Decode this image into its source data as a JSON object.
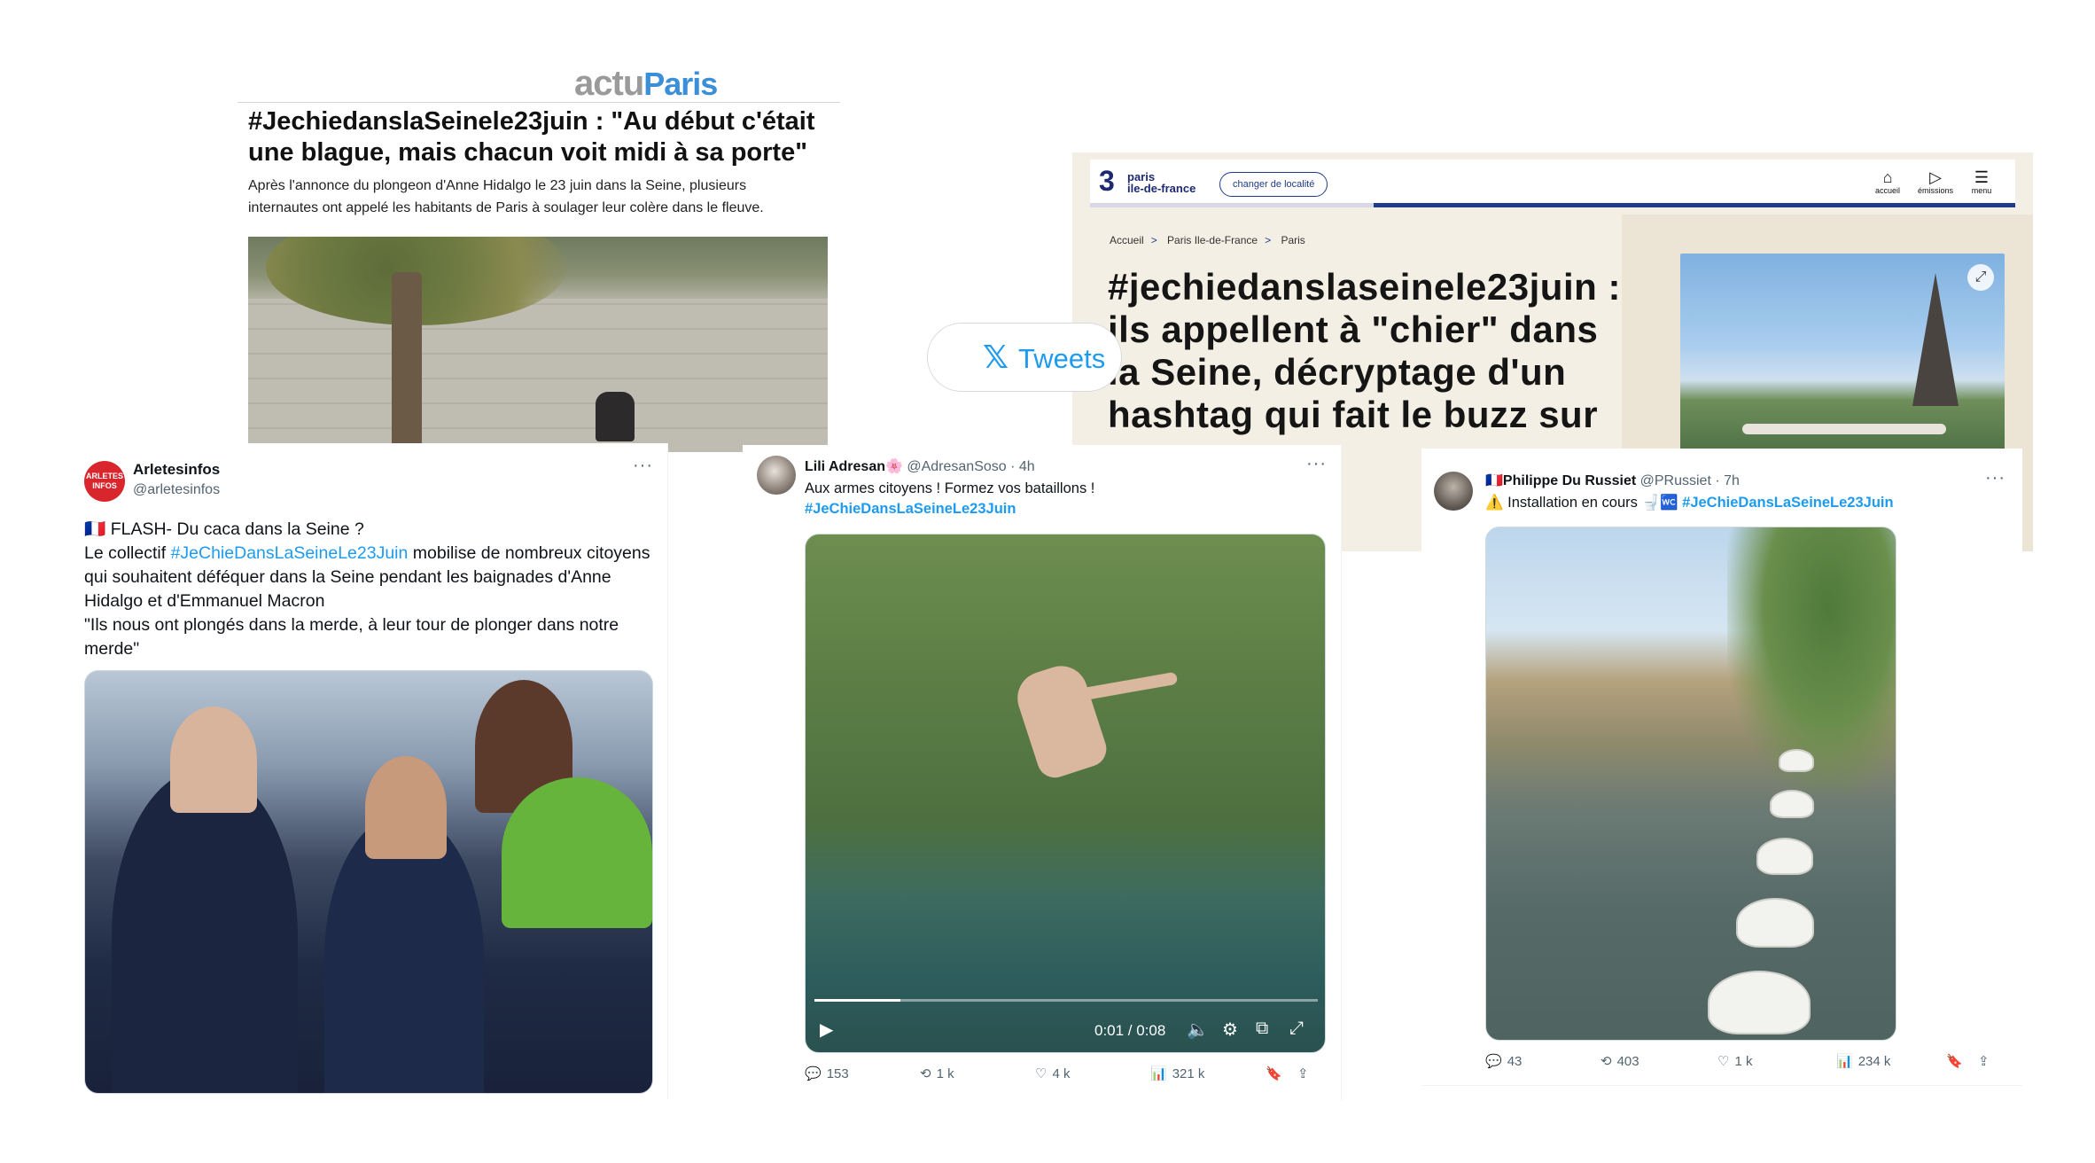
{
  "actu": {
    "logo_actu": "actu",
    "logo_paris": "Paris",
    "headline": "#JechiedanslaSeinele23juin : \"Au début c'était une blague, mais chacun voit midi à sa porte\"",
    "lead": "Après l'annonce du plongeon d'Anne Hidalgo le 23 juin dans la Seine, plusieurs internautes ont appelé les habitants de Paris à soulager leur colère dans le fleuve."
  },
  "tweets_pill": {
    "icon": "x-logo-icon",
    "label": "Tweets"
  },
  "france3": {
    "brand_num": "3",
    "brand_line1": "paris",
    "brand_line2": "ile-de-france",
    "location_button": "changer de localité",
    "nav": [
      {
        "icon": "⌂",
        "label": "accueil"
      },
      {
        "icon": "▷",
        "label": "émissions"
      },
      {
        "icon": "☰",
        "label": "menu"
      }
    ],
    "breadcrumb": [
      "Accueil",
      "Paris Ile-de-France",
      "Paris"
    ],
    "breadcrumb_sep": ">",
    "title": "#jechiedanslaseinele23juin : ils appellent à \"chier\" dans la Seine, décryptage d'un hashtag qui fait le buzz sur",
    "accent_color": "#1f3b8c"
  },
  "tweet1": {
    "avatar_text": "ARLETES INFOS",
    "name": "Arletesinfos",
    "handle": "@arletesinfos",
    "more": "···",
    "line1": "🇫🇷 FLASH- Du caca dans la Seine ?",
    "line2_pre": "Le collectif ",
    "line2_tag": "#JeChieDansLaSeineLe23Juin",
    "line2_post": " mobilise de nombreux citoyens qui souhaitent déféquer dans la Seine pendant les baignades d'Anne Hidalgo et d'Emmanuel Macron",
    "line3": "\"Ils nous ont plongés dans la merde, à leur tour de plonger dans notre merde\""
  },
  "tweet2": {
    "name": "Lili Adresan🌸",
    "handle": "@AdresanSoso · 4h",
    "more": "···",
    "text": "Aux armes citoyens ! Formez vos bataillons !",
    "hashtag": "#JeChieDansLaSeineLe23Juin",
    "video_time": "0:01 / 0:08",
    "video_progress": 0.17,
    "actions": {
      "replies": "153",
      "retweets": "1 k",
      "likes": "4 k",
      "views": "321 k"
    }
  },
  "tweet3": {
    "name": "🇫🇷Philippe Du Russiet",
    "handle": "@PRussiet · 7h",
    "more": "···",
    "text_pre": "⚠️ Installation en cours 🚽🚾 ",
    "hashtag": "#JeChieDansLaSeineLe23Juin",
    "actions": {
      "replies": "43",
      "retweets": "403",
      "likes": "1 k",
      "views": "234 k"
    }
  },
  "colors": {
    "twitter_blue": "#1d9bf0",
    "actu_blue": "#3b8ed8",
    "france3_navy": "#1d2a72"
  }
}
